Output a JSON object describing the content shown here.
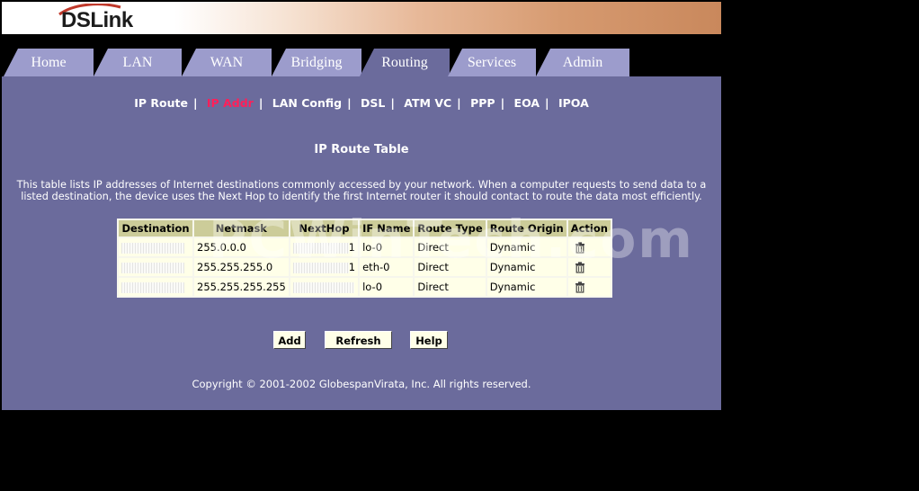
{
  "brand": {
    "logo_text": "DSLink"
  },
  "tabs": [
    {
      "label": "Home"
    },
    {
      "label": "LAN"
    },
    {
      "label": "WAN"
    },
    {
      "label": "Bridging"
    },
    {
      "label": "Routing"
    },
    {
      "label": "Services"
    },
    {
      "label": "Admin"
    }
  ],
  "active_tab": "Routing",
  "subnav": [
    {
      "label": "IP Route"
    },
    {
      "label": "IP Addr"
    },
    {
      "label": "LAN Config"
    },
    {
      "label": "DSL"
    },
    {
      "label": "ATM VC"
    },
    {
      "label": "PPP"
    },
    {
      "label": "EOA"
    },
    {
      "label": "IPOA"
    }
  ],
  "active_subnav": "IP Addr",
  "page": {
    "title": "IP Route Table",
    "description": "This table lists IP addresses of Internet destinations commonly accessed by your network. When a computer requests to send data to a listed destination, the device uses the Next Hop to identify the first Internet router it should contact to route the data most efficiently."
  },
  "table": {
    "headers": [
      "Destination",
      "Netmask",
      "NextHop",
      "IF Name",
      "Route Type",
      "Route Origin",
      "Action"
    ],
    "rows": [
      {
        "destination": "",
        "netmask": "255.0.0.0",
        "nexthop": "1",
        "ifname": "lo-0",
        "route_type": "Direct",
        "route_origin": "Dynamic"
      },
      {
        "destination": "",
        "netmask": "255.255.255.0",
        "nexthop": "1",
        "ifname": "eth-0",
        "route_type": "Direct",
        "route_origin": "Dynamic"
      },
      {
        "destination": "",
        "netmask": "255.255.255.255",
        "nexthop": "",
        "ifname": "lo-0",
        "route_type": "Direct",
        "route_origin": "Dynamic"
      }
    ]
  },
  "buttons": {
    "add": "Add",
    "refresh": "Refresh",
    "help": "Help"
  },
  "footer": {
    "copyright": "Copyright © 2001-2002 GlobespanVirata, Inc. All rights reserved."
  },
  "watermark": "PCWinTech.com",
  "colors": {
    "panel": "#6b6b9c",
    "tab": "#9c9ccc",
    "table_header": "#cccc99",
    "table_cell": "#ffffe8",
    "active_link": "#ff1f5a"
  }
}
